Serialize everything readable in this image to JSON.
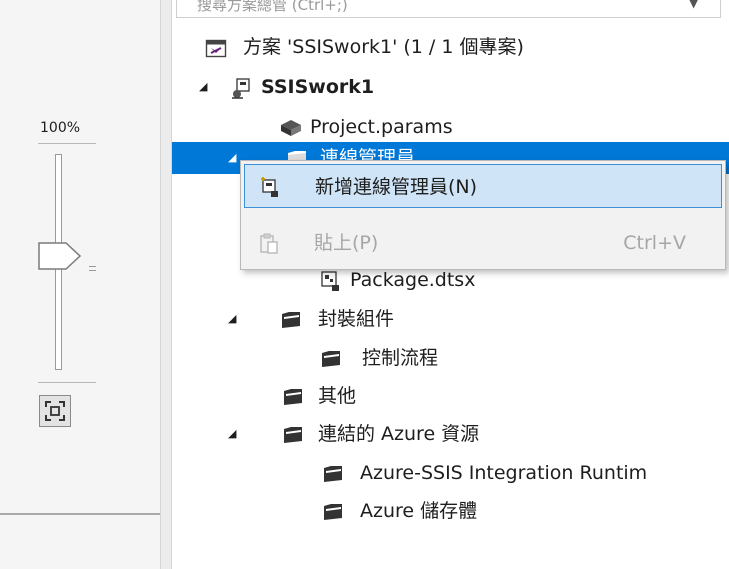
{
  "zoom": {
    "level_label": "100%",
    "slider_level_percent": 53
  },
  "search": {
    "placeholder": "搜尋方案總管 (Ctrl+;)"
  },
  "tree": {
    "solution": {
      "label": "方案 'SSISwork1' (1 / 1 個專案)",
      "icon": "solution-icon"
    },
    "project": {
      "label": "SSISwork1",
      "icon": "ssis-project-icon"
    },
    "project_params": {
      "label": "Project.params",
      "icon": "params-icon"
    },
    "connection_managers": {
      "label": "連線管理員",
      "icon": "folder-icon"
    },
    "package": {
      "label": "Package.dtsx",
      "icon": "package-icon"
    },
    "package_parts": {
      "label": "封裝組件",
      "icon": "folder-icon"
    },
    "control_flow": {
      "label": "控制流程",
      "icon": "folder-icon"
    },
    "misc": {
      "label": "其他",
      "icon": "folder-icon"
    },
    "linked_azure": {
      "label": "連結的 Azure 資源",
      "icon": "folder-icon"
    },
    "azure_ssis_ir": {
      "label": "Azure-SSIS Integration Runtim",
      "icon": "folder-icon"
    },
    "azure_storage": {
      "label": "Azure 儲存體",
      "icon": "folder-icon"
    }
  },
  "context_menu": {
    "new_connection_manager": {
      "label": "新增連線管理員(N)",
      "icon": "new-connection-icon"
    },
    "paste": {
      "label": "貼上(P)",
      "shortcut": "Ctrl+V",
      "icon": "paste-icon",
      "enabled": false
    }
  },
  "colors": {
    "selection": "#0078d7",
    "menu_highlight": "#cfe4f7",
    "menu_highlight_border": "#3d8fd8",
    "disabled_text": "#a6a6a6"
  }
}
